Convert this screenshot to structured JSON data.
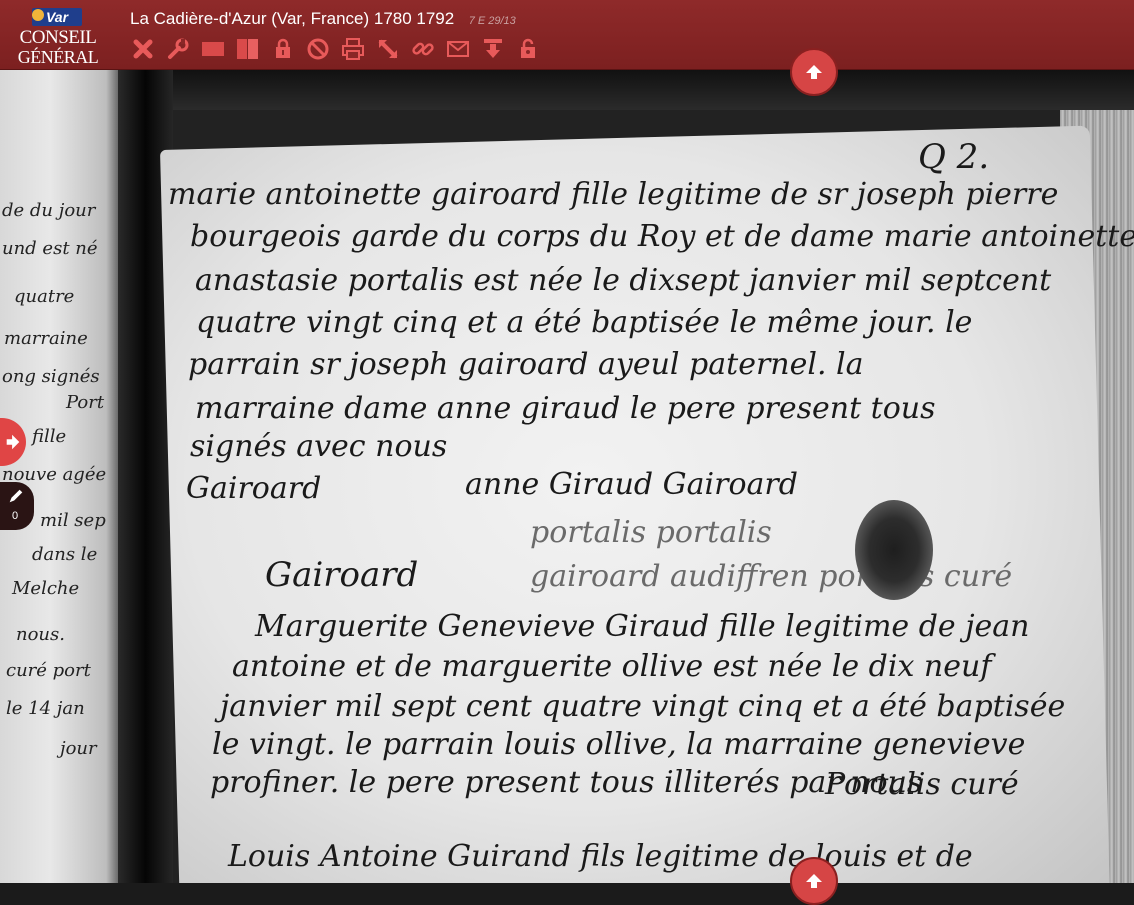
{
  "header": {
    "logo": {
      "badge": "Var",
      "line1": "CONSEIL",
      "line2": "GÉNÉRAL"
    },
    "title": "La Cadière-d'Azur (Var, France) 1780 1792",
    "cote": "7 E 29/13"
  },
  "toolbar": {
    "tools": [
      "close-icon",
      "settings-wrench-icon",
      "single-page-icon",
      "double-page-icon",
      "lock-icon",
      "forbidden-icon",
      "print-icon",
      "fullscreen-icon",
      "link-icon",
      "mail-icon",
      "download-icon",
      "unlock-icon"
    ]
  },
  "colors": {
    "bar": "#8b2727",
    "accent": "#d64545"
  },
  "annotations": {
    "count": "0"
  },
  "document": {
    "page_ref": "Q 2.",
    "lines": [
      "marie antoinette gairoard fille legitime de sr joseph pierre",
      "bourgeois garde du corps du Roy et de dame marie antoinette",
      "anastasie portalis est née le dixsept janvier mil septcent",
      "quatre vingt cinq et a été baptisée le même jour. le",
      "parrain sr joseph gairoard ayeul paternel. la",
      "marraine dame anne giraud le pere present tous",
      "signés avec nous"
    ],
    "signatures_1": [
      "Gairoard",
      "anne Giraud Gairoard",
      "portalis portalis",
      "gairoard audiffren portalis curé"
    ],
    "lines_2": [
      "Marguerite Genevieve Giraud fille legitime de jean",
      "antoine et de marguerite ollive est née le dix neuf",
      "janvier mil sept cent quatre vingt cinq et a été baptisée",
      "le vingt. le parrain louis ollive, la marraine genevieve",
      "profiner. le pere present tous illiterés par nous"
    ],
    "sig_2": "Portalis curé",
    "margin_2": "Gairoard",
    "line_3": "Louis Antoine Guirand fils legitime de louis et de",
    "left_margin": [
      "de du jour",
      "und est né",
      "quatre",
      "marraine",
      "ong signés",
      "Port",
      "fille",
      "nouve agée",
      "mil sep",
      "dans le",
      "Melche",
      "nous.",
      "curé port",
      "le 14 jan",
      "jour"
    ]
  }
}
